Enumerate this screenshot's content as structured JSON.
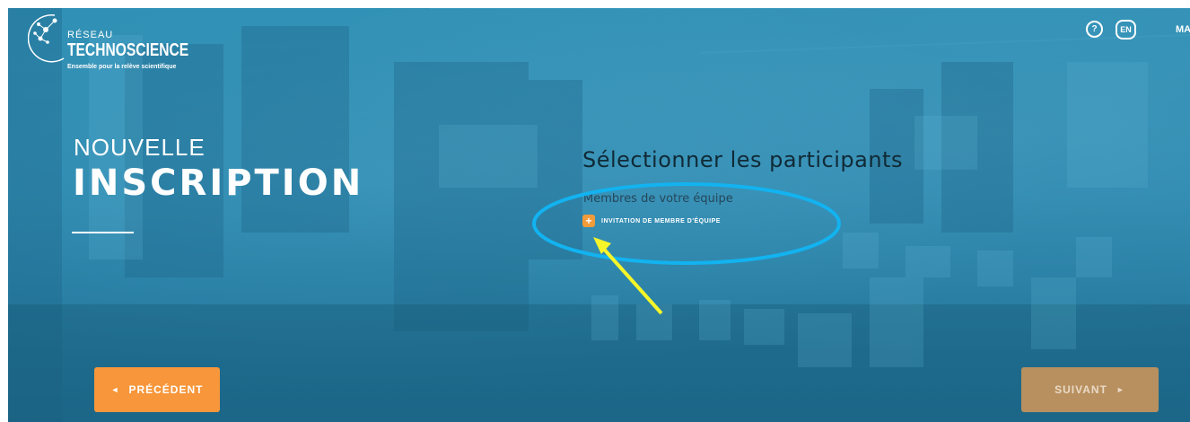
{
  "brand": {
    "reseau": "RÉSEAU",
    "name": "TECHNOSCIENCE",
    "tagline": "Ensemble pour la relève scientifique"
  },
  "header": {
    "help_label": "?",
    "lang_label": "EN",
    "menu_label": "MA"
  },
  "hero": {
    "title_small": "NOUVELLE",
    "title_big": "INSCRIPTION"
  },
  "main": {
    "section_title": "Sélectionner les participants",
    "section_subtitle": "Membres de votre équipe",
    "invite_icon": "+",
    "invite_label": "INVITATION DE MEMBRE D'ÉQUIPE"
  },
  "nav": {
    "prev_arrow": "◄",
    "prev_label": "PRÉCÉDENT",
    "next_label": "SUIVANT",
    "next_arrow": "►"
  },
  "colors": {
    "background": "#2a86ad",
    "accent_orange": "#f7963a",
    "next_disabled": "#b8905f",
    "annotation_ellipse": "#12b3f0",
    "annotation_arrow": "#f5f52a"
  }
}
